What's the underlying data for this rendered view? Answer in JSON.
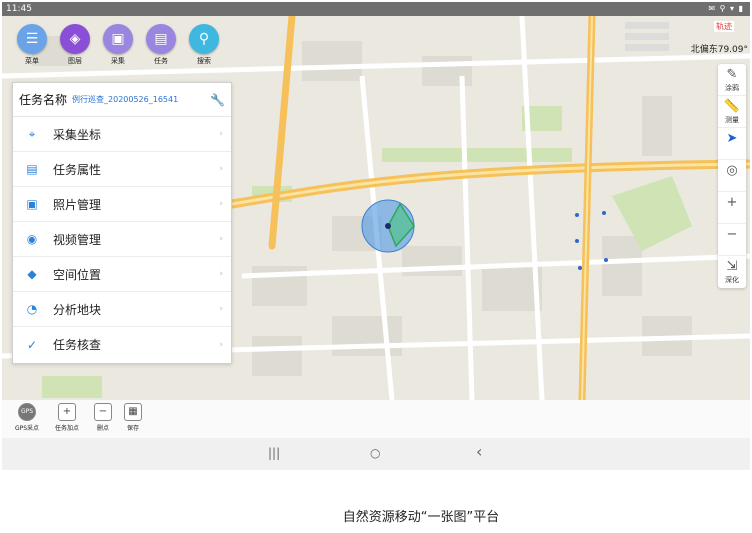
{
  "statusbar": {
    "time": "11:45",
    "icons": "✉ ⚲ ▾ ▮"
  },
  "topbar": {
    "buttons": [
      {
        "label": "菜单",
        "icon": "menu-icon",
        "color": "#6aa3e8"
      },
      {
        "label": "图层",
        "icon": "layers-icon",
        "color": "#8a4fd6"
      },
      {
        "label": "采集",
        "icon": "collect-icon",
        "color": "#9a86e0"
      },
      {
        "label": "任务",
        "icon": "task-icon",
        "color": "#9a86e0"
      },
      {
        "label": "搜索",
        "icon": "search-icon",
        "color": "#3fb8e0"
      }
    ]
  },
  "info": {
    "tag": "轨迹",
    "bearing": "北偏东79.09°"
  },
  "rightbar": {
    "items": [
      {
        "label": "涂鸦",
        "icon": "graffiti-icon"
      },
      {
        "label": "测量",
        "icon": "ruler-icon"
      },
      {
        "label": "",
        "icon": "locate-arrow-icon"
      },
      {
        "label": "",
        "icon": "target-icon"
      },
      {
        "label": "",
        "icon": "zoom-in-icon"
      },
      {
        "label": "",
        "icon": "zoom-out-icon"
      },
      {
        "label": "深化",
        "icon": "deepen-icon"
      }
    ]
  },
  "task": {
    "title": "任务名称",
    "name": "例行巡查_20200526_16541",
    "items": [
      {
        "label": "采集坐标",
        "icon": "coordinate-icon",
        "glyph": "⌖"
      },
      {
        "label": "任务属性",
        "icon": "attributes-icon",
        "glyph": "▤"
      },
      {
        "label": "照片管理",
        "icon": "photo-icon",
        "glyph": "▣"
      },
      {
        "label": "视频管理",
        "icon": "video-icon",
        "glyph": "◉"
      },
      {
        "label": "空间位置",
        "icon": "cube-icon",
        "glyph": "◆"
      },
      {
        "label": "分析地块",
        "icon": "pie-icon",
        "glyph": "◔"
      },
      {
        "label": "任务核查",
        "icon": "check-icon",
        "glyph": "✓"
      }
    ]
  },
  "tools": [
    {
      "label": "GPS采点",
      "icon": "gps-icon",
      "glyph": "GPS"
    },
    {
      "label": "任务加点",
      "icon": "add-point-icon",
      "glyph": "+"
    },
    {
      "label": "删点",
      "icon": "delete-point-icon",
      "glyph": "−"
    },
    {
      "label": "保存",
      "icon": "save-icon",
      "glyph": "▦"
    }
  ],
  "nav": {
    "recent": "|||",
    "home": "○",
    "back": "‹"
  },
  "caption": "自然资源移动“一张图”平台"
}
